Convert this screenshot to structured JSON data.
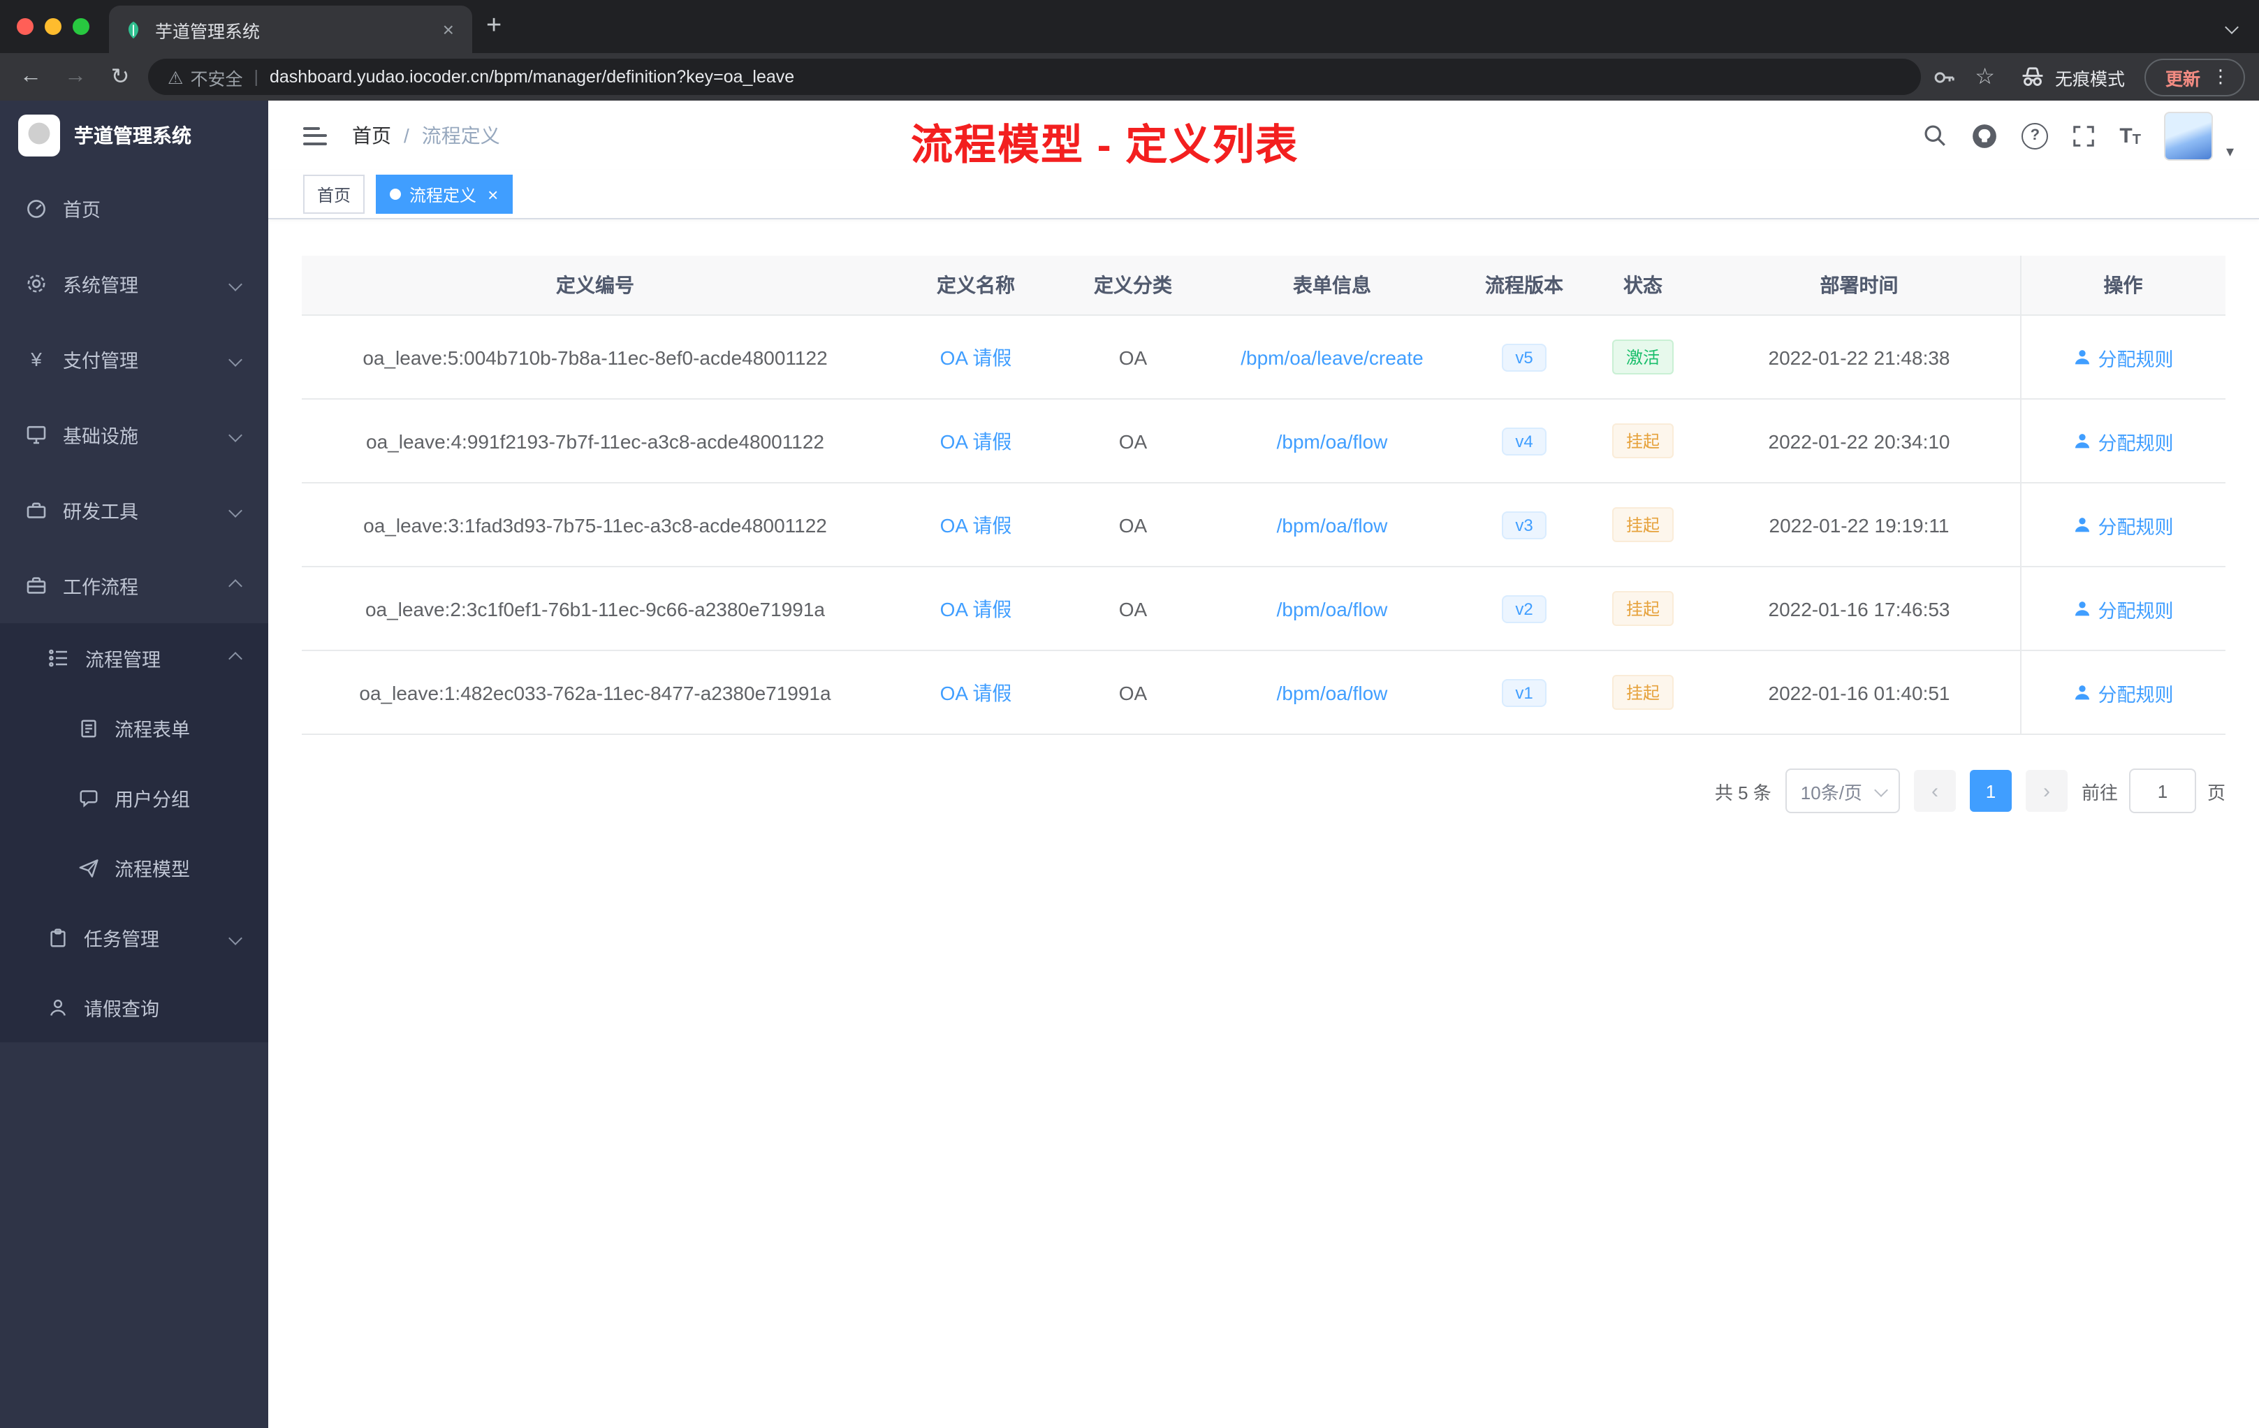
{
  "colors": {
    "accent": "#409eff",
    "success": "#19be6b",
    "warning": "#e6a23c",
    "annotation_red": "#f31f1f",
    "sidebar_bg": "#2f3447",
    "sidebar_sub_bg": "#262b3e",
    "chrome_frame": "#202124",
    "chrome_toolbar": "#35363a"
  },
  "icons": {
    "close": "×",
    "new_tab": "+",
    "back": "←",
    "forward": "→",
    "reload": "↻",
    "warning": "⚠",
    "pipe": "|",
    "star": "☆",
    "kebab": "⋮",
    "caret": "▾",
    "prev": "‹",
    "next": "›",
    "yen": "¥",
    "question": "?",
    "font_big": "T",
    "font_small": "T",
    "slash": "/"
  },
  "browser": {
    "tab_title": "芋道管理系统",
    "security_label": "不安全",
    "url": "dashboard.yudao.iocoder.cn/bpm/manager/definition?key=oa_leave",
    "incognito_label": "无痕模式",
    "update_label": "更新"
  },
  "sidebar": {
    "title": "芋道管理系统",
    "items": [
      {
        "label": "首页"
      },
      {
        "label": "系统管理"
      },
      {
        "label": "支付管理"
      },
      {
        "label": "基础设施"
      },
      {
        "label": "研发工具"
      },
      {
        "label": "工作流程"
      },
      {
        "label": "流程管理"
      },
      {
        "label": "流程表单"
      },
      {
        "label": "用户分组"
      },
      {
        "label": "流程模型"
      },
      {
        "label": "任务管理"
      },
      {
        "label": "请假查询"
      }
    ]
  },
  "header": {
    "breadcrumb_home": "首页",
    "breadcrumb_current": "流程定义",
    "annotation": "流程模型 - 定义列表"
  },
  "tags": {
    "home": "首页",
    "active": "流程定义"
  },
  "table": {
    "columns": [
      "定义编号",
      "定义名称",
      "定义分类",
      "表单信息",
      "流程版本",
      "状态",
      "部署时间",
      "操作"
    ],
    "rows": [
      {
        "id": "oa_leave:5:004b710b-7b8a-11ec-8ef0-acde48001122",
        "name": "OA 请假",
        "category": "OA",
        "form": "/bpm/oa/leave/create",
        "version": "v5",
        "status": "激活",
        "status_type": "success",
        "time": "2022-01-22 21:48:38",
        "action": "分配规则"
      },
      {
        "id": "oa_leave:4:991f2193-7b7f-11ec-a3c8-acde48001122",
        "name": "OA 请假",
        "category": "OA",
        "form": "/bpm/oa/flow",
        "version": "v4",
        "status": "挂起",
        "status_type": "warning",
        "time": "2022-01-22 20:34:10",
        "action": "分配规则"
      },
      {
        "id": "oa_leave:3:1fad3d93-7b75-11ec-a3c8-acde48001122",
        "name": "OA 请假",
        "category": "OA",
        "form": "/bpm/oa/flow",
        "version": "v3",
        "status": "挂起",
        "status_type": "warning",
        "time": "2022-01-22 19:19:11",
        "action": "分配规则"
      },
      {
        "id": "oa_leave:2:3c1f0ef1-76b1-11ec-9c66-a2380e71991a",
        "name": "OA 请假",
        "category": "OA",
        "form": "/bpm/oa/flow",
        "version": "v2",
        "status": "挂起",
        "status_type": "warning",
        "time": "2022-01-16 17:46:53",
        "action": "分配规则"
      },
      {
        "id": "oa_leave:1:482ec033-762a-11ec-8477-a2380e71991a",
        "name": "OA 请假",
        "category": "OA",
        "form": "/bpm/oa/flow",
        "version": "v1",
        "status": "挂起",
        "status_type": "warning",
        "time": "2022-01-16 01:40:51",
        "action": "分配规则"
      }
    ]
  },
  "pagination": {
    "total": "共 5 条",
    "page_size": "10条/页",
    "page": "1",
    "goto_label": "前往",
    "goto_value": "1",
    "unit_label": "页"
  }
}
